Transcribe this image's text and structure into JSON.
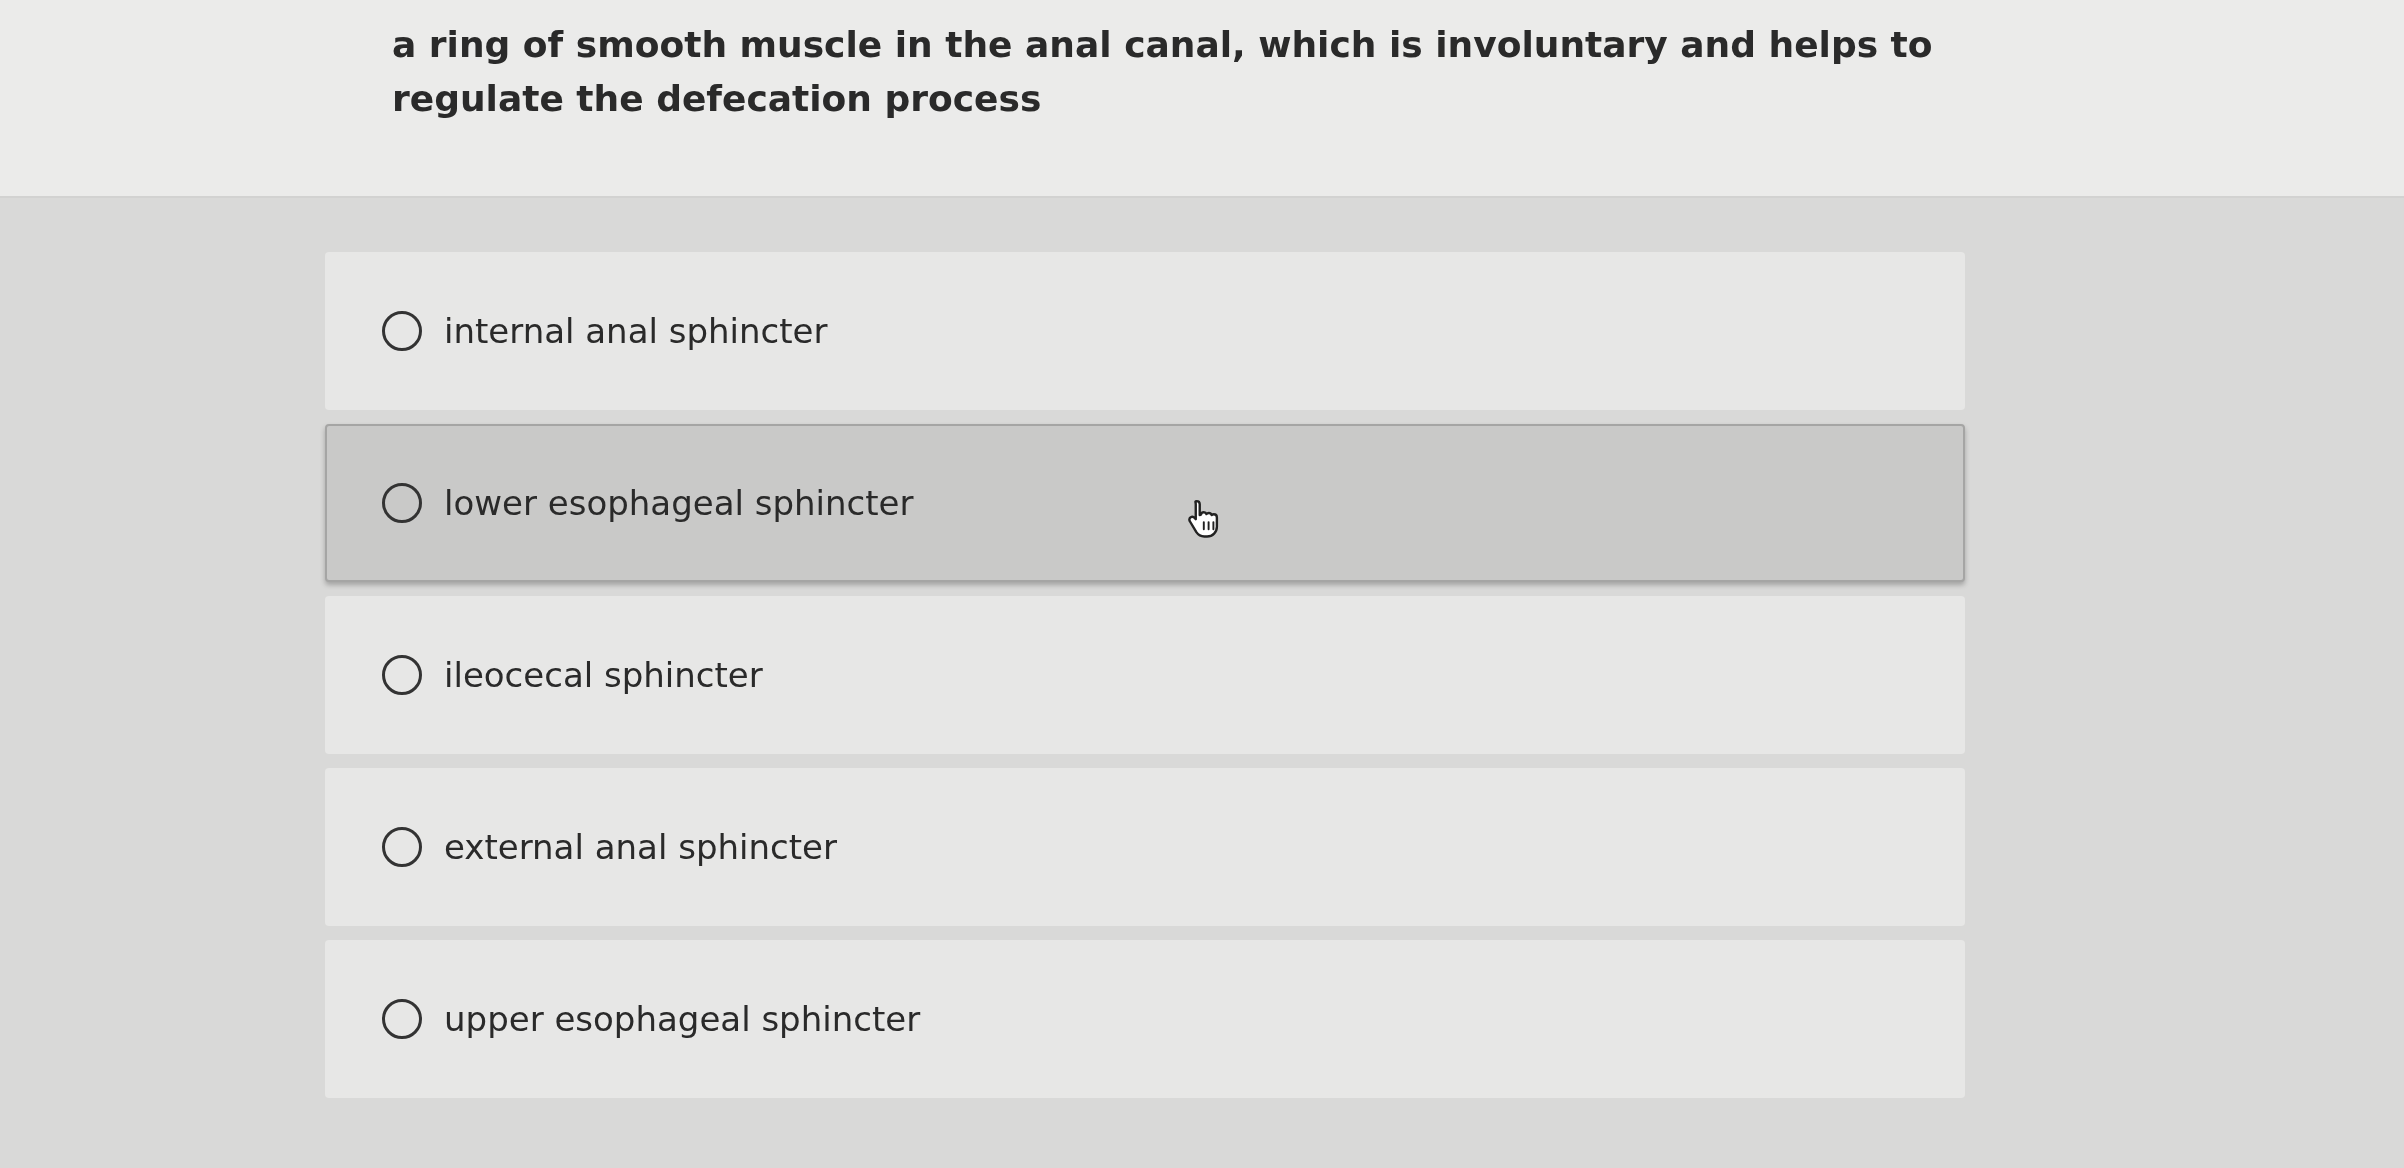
{
  "question": {
    "text": "a ring of smooth muscle in the anal canal, which is involuntary and helps to regulate the defecation process"
  },
  "options": [
    {
      "label": "internal anal sphincter",
      "selected": false,
      "hovered": false
    },
    {
      "label": "lower esophageal sphincter",
      "selected": false,
      "hovered": true
    },
    {
      "label": "ileocecal sphincter",
      "selected": false,
      "hovered": false
    },
    {
      "label": "external anal sphincter",
      "selected": false,
      "hovered": false
    },
    {
      "label": "upper esophageal sphincter",
      "selected": false,
      "hovered": false
    }
  ]
}
